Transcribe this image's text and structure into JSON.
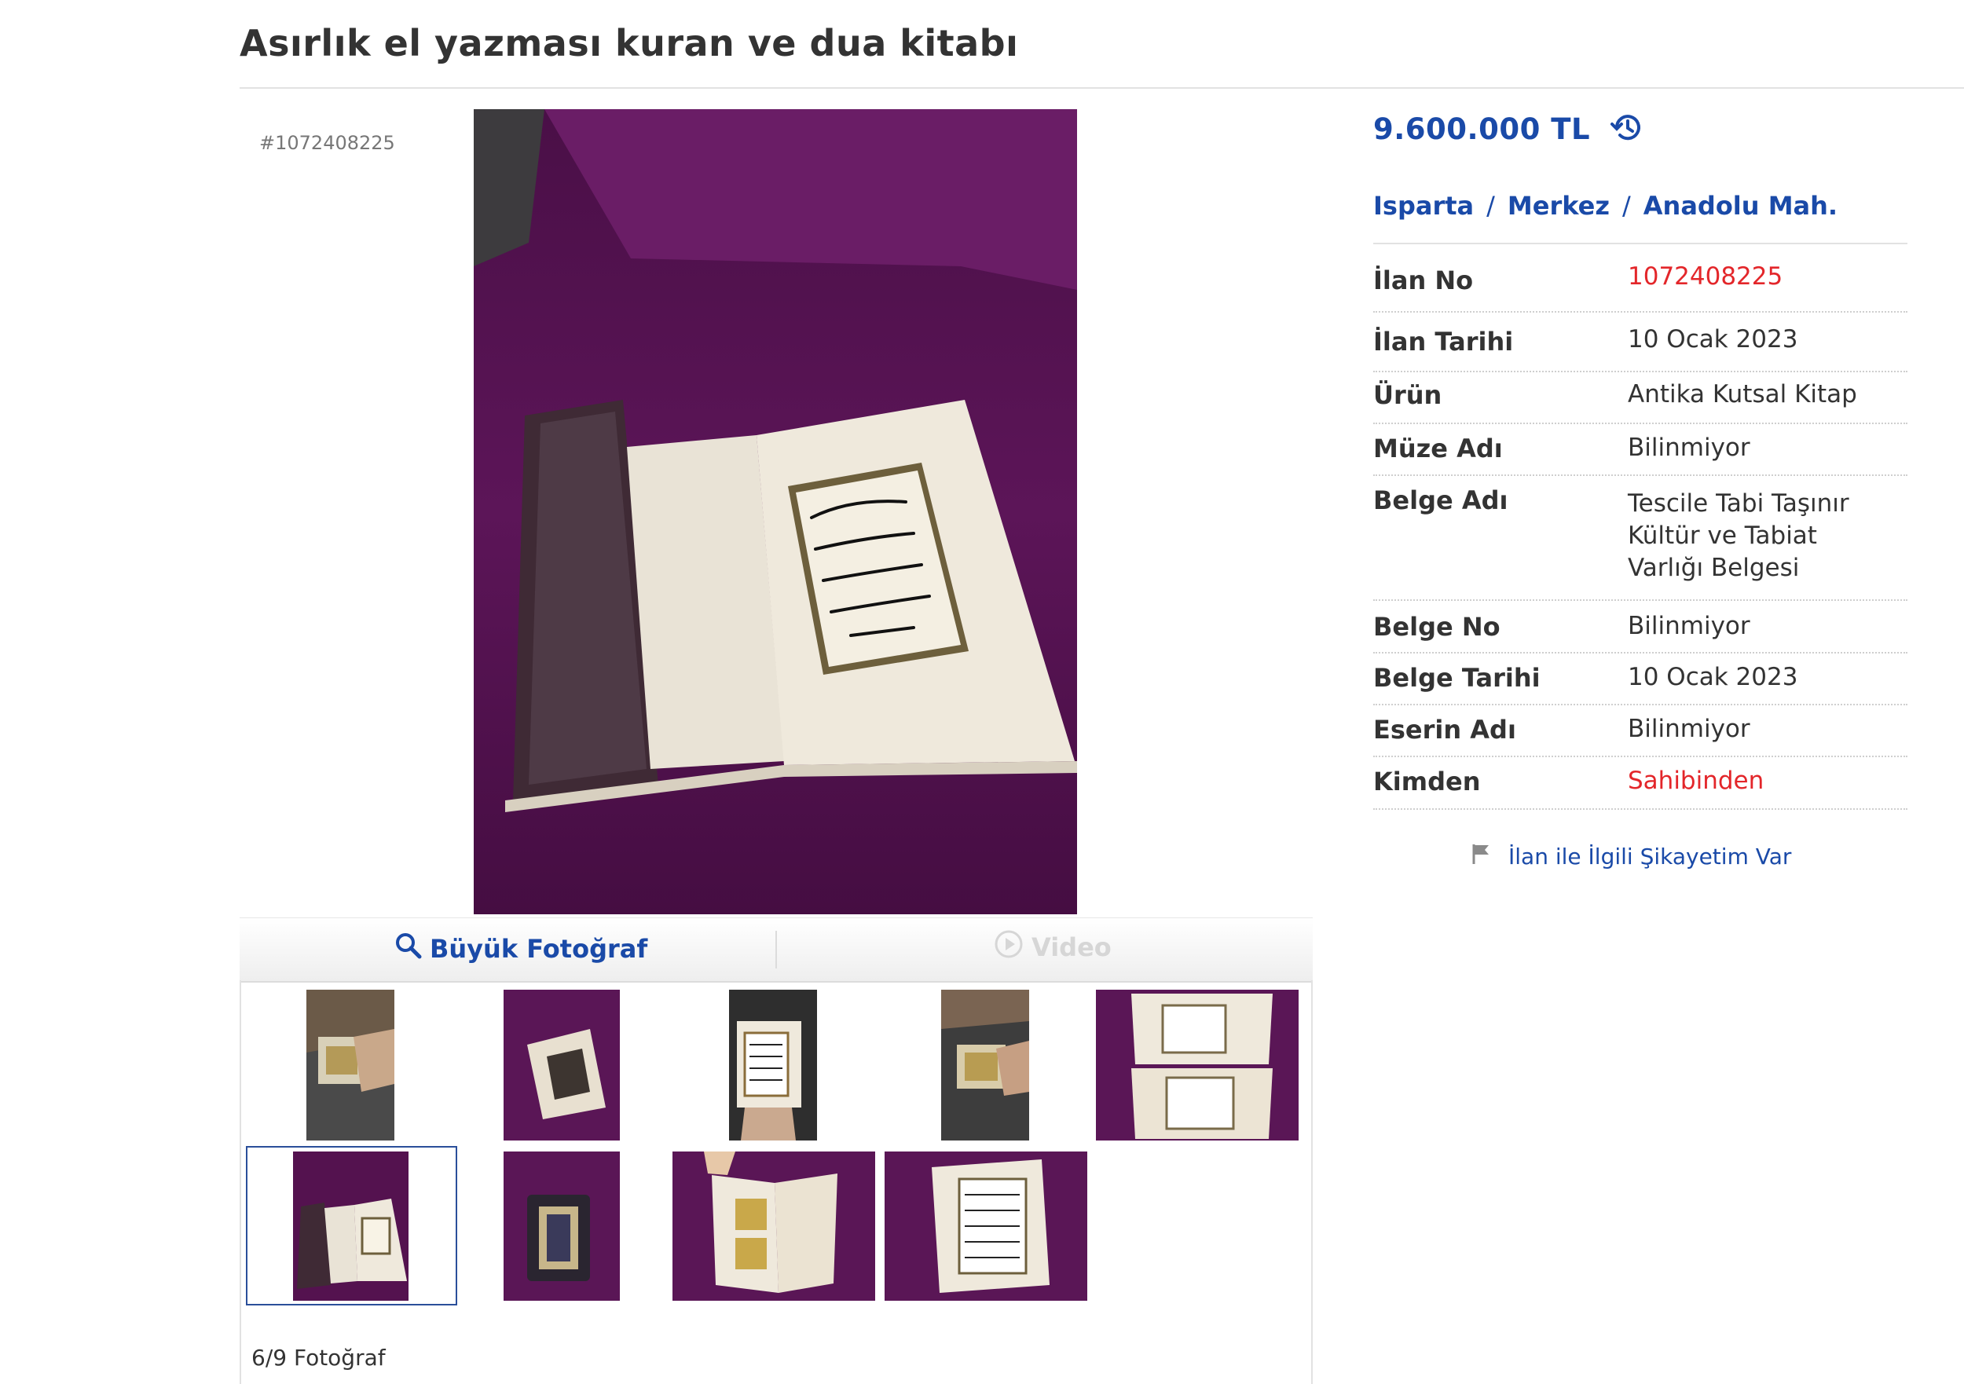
{
  "listing": {
    "title": "Asırlık el yazması kuran ve dua kitabı",
    "ref": "#1072408225",
    "price": "9.600.000 TL",
    "location": {
      "city": "Isparta",
      "district": "Merkez",
      "neighborhood": "Anadolu Mah.",
      "separator": "/"
    }
  },
  "photo_tabs": {
    "big_photo": "Büyük Fotoğraf",
    "video": "Video"
  },
  "photo_counter": "6/9 Fotoğraf",
  "details": [
    {
      "label": "İlan No",
      "value": "1072408225",
      "highlight": true
    },
    {
      "label": "İlan Tarihi",
      "value": "10 Ocak 2023",
      "highlight": false
    },
    {
      "label": "Ürün",
      "value": "Antika Kutsal Kitap",
      "highlight": false
    },
    {
      "label": "Müze Adı",
      "value": "Bilinmiyor",
      "highlight": false
    },
    {
      "label": "Belge Adı",
      "value": "Tescile Tabi Taşınır Kültür ve Tabiat Varlığı Belgesi",
      "lines": [
        "Tescile Tabi Taşınır",
        "Kültür ve Tabiat",
        "Varlığı Belgesi"
      ],
      "highlight": false
    },
    {
      "label": "Belge No",
      "value": "Bilinmiyor",
      "highlight": false
    },
    {
      "label": "Belge Tarihi",
      "value": "10 Ocak 2023",
      "highlight": false
    },
    {
      "label": "Eserin Adı",
      "value": "Bilinmiyor",
      "highlight": false
    },
    {
      "label": "Kimden",
      "value": "Sahibinden",
      "highlight": true
    }
  ],
  "complaint_link": "İlan ile İlgili Şikayetim Var",
  "thumbnails": {
    "count": 9,
    "selected_index": 6
  },
  "icons": {
    "history": "history-icon",
    "search": "search-icon",
    "play": "play-icon",
    "flag": "flag-icon"
  },
  "colors": {
    "link_blue": "#1a4aa8",
    "highlight_red": "#e3262a",
    "photo_purple": "#54124f"
  }
}
